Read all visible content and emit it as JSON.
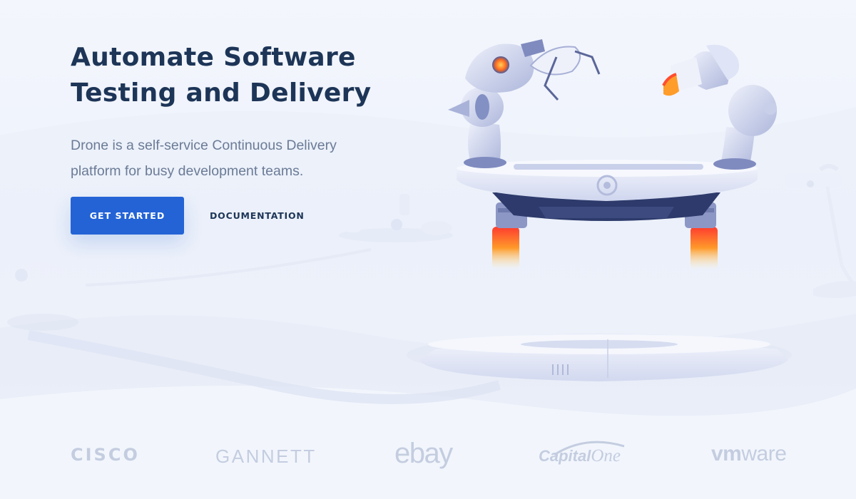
{
  "hero": {
    "title_line1": "Automate Software",
    "title_line2": "Testing and Delivery",
    "subtitle_line1": "Drone is a self-service Continuous Delivery",
    "subtitle_line2": "platform for busy development teams."
  },
  "actions": {
    "primary_label": "GET STARTED",
    "secondary_label": "DOCUMENTATION"
  },
  "logos": {
    "cisco": "CISCO",
    "gannett": "GANNETT",
    "ebay": "ebay",
    "capitalone_cap": "Capital",
    "capitalone_one": "One",
    "vmware_vm": "vm",
    "vmware_ware": "ware"
  },
  "colors": {
    "title": "#1d3557",
    "subtitle": "#6b7b96",
    "primary_button": "#2363d6",
    "logo": "#c4cde0",
    "background": "#eef2fb"
  },
  "icons": {
    "illustration": "robot-drone-illustration"
  }
}
